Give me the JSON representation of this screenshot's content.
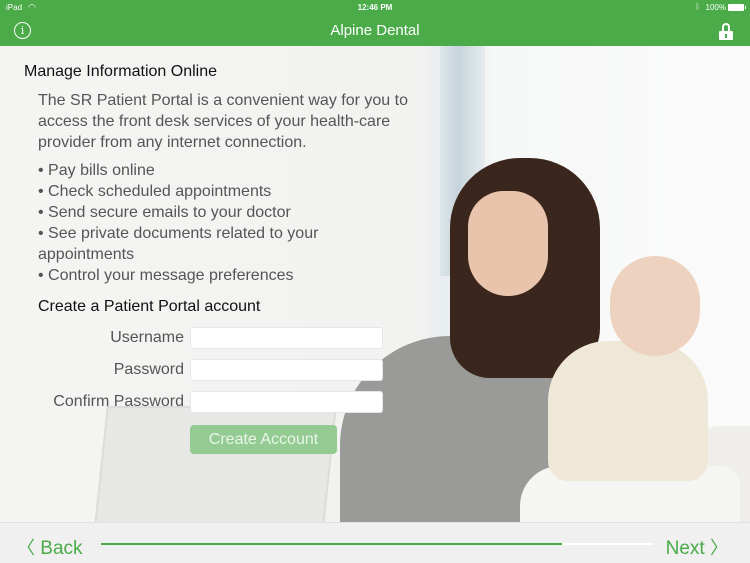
{
  "status_bar": {
    "device": "iPad",
    "time": "12:46 PM",
    "battery_percent": "100%"
  },
  "nav": {
    "title": "Alpine Dental",
    "left_icon": "info-icon",
    "right_icon": "unlock-icon",
    "info_glyph": "i"
  },
  "content": {
    "heading": "Manage Information Online",
    "intro": "The SR Patient Portal is a convenient way for you to access the front desk services of your health-care provider from any internet connection.",
    "bullets": [
      "• Pay bills online",
      "• Check scheduled appointments",
      "• Send secure emails to your doctor",
      "• See private documents related to your appointments",
      "• Control your message preferences"
    ],
    "form_title": "Create a Patient Portal account",
    "fields": [
      {
        "label": "Username",
        "value": "",
        "placeholder": ""
      },
      {
        "label": "Password",
        "value": "",
        "placeholder": ""
      },
      {
        "label": "Confirm Password",
        "value": "",
        "placeholder": ""
      }
    ],
    "create_button": "Create Account"
  },
  "footer": {
    "back_label": "Back",
    "next_label": "Next",
    "back_chevron": "〈",
    "next_chevron": "〉",
    "progress_fraction": 0.835
  },
  "colors": {
    "accent": "#4aab48",
    "button_disabled": "#94cb93"
  }
}
